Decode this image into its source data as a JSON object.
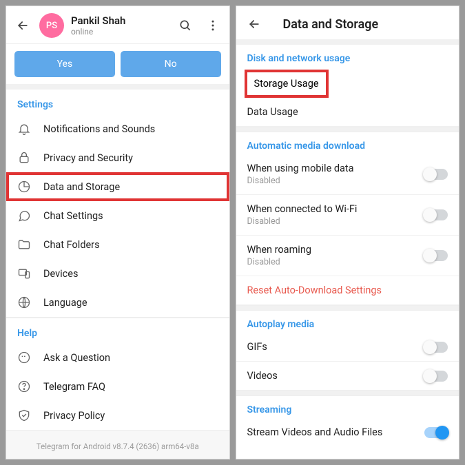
{
  "left": {
    "avatar_initials": "PS",
    "name": "Pankil Shah",
    "status": "online",
    "yes": "Yes",
    "no": "No",
    "settings_header": "Settings",
    "items": [
      "Notifications and Sounds",
      "Privacy and Security",
      "Data and Storage",
      "Chat Settings",
      "Chat Folders",
      "Devices",
      "Language"
    ],
    "help_header": "Help",
    "help_items": [
      "Ask a Question",
      "Telegram FAQ",
      "Privacy Policy"
    ],
    "footer": "Telegram for Android v8.7.4 (2636) arm64-v8a"
  },
  "right": {
    "title": "Data and Storage",
    "disk_header": "Disk and network usage",
    "storage_usage": "Storage Usage",
    "data_usage": "Data Usage",
    "auto_header": "Automatic media download",
    "auto_items": [
      {
        "label": "When using mobile data",
        "sub": "Disabled"
      },
      {
        "label": "When connected to Wi-Fi",
        "sub": "Disabled"
      },
      {
        "label": "When roaming",
        "sub": "Disabled"
      }
    ],
    "reset": "Reset Auto-Download Settings",
    "autoplay_header": "Autoplay media",
    "autoplay_items": [
      "GIFs",
      "Videos"
    ],
    "stream_header": "Streaming",
    "stream_item": "Stream Videos and Audio Files"
  }
}
